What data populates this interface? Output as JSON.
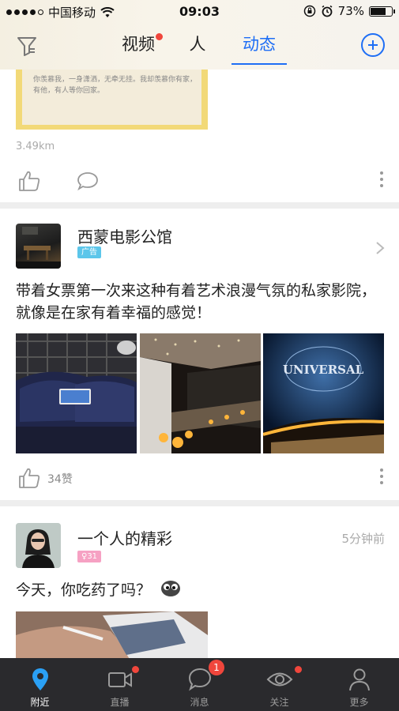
{
  "status_bar": {
    "carrier": "中国移动",
    "time": "09:03",
    "battery": "73%",
    "battery_level": 0.73
  },
  "header": {
    "tabs": [
      {
        "label": "视频",
        "has_dot": true
      },
      {
        "label": "人",
        "has_dot": false
      },
      {
        "label": "动态",
        "active": true
      }
    ],
    "accent_color": "#1e6ef5"
  },
  "post_previous": {
    "image_text": "你羡慕我，一身潇洒，无牵无挂。我却羡慕你有家，有他，有人等你回家。",
    "distance": "3.49km"
  },
  "post_ad": {
    "name": "西蒙电影公馆",
    "tag": "广告",
    "text": "带着女票第一次来这种有着艺术浪漫气氛的私家影院，就像是在家有着幸福的感觉！",
    "photo3_text": "UNIVERSAL",
    "likes": "34赞"
  },
  "post_user": {
    "name": "一个人的精彩",
    "tag": "♀31",
    "time": "5分钟前",
    "text": "今天，你吃药了吗？"
  },
  "bottom_nav": [
    {
      "label": "附近",
      "icon": "location-pin-icon",
      "active": true
    },
    {
      "label": "直播",
      "icon": "video-camera-icon",
      "dot": true
    },
    {
      "label": "消息",
      "icon": "chat-bubble-icon",
      "badge": "1"
    },
    {
      "label": "关注",
      "icon": "eye-icon",
      "dot": true
    },
    {
      "label": "更多",
      "icon": "person-icon"
    }
  ]
}
